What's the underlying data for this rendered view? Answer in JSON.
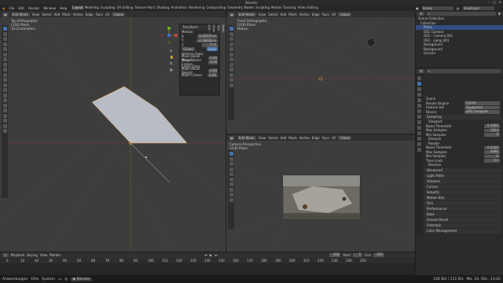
{
  "window": {
    "title": "Blender"
  },
  "menu": [
    "File",
    "Edit",
    "Render",
    "Window",
    "Help"
  ],
  "workspaces": [
    "Layout",
    "Modeling",
    "Sculpting",
    "UV Editing",
    "Texture Paint",
    "Shading",
    "Animation",
    "Rendering",
    "Compositing",
    "Geometry Nodes",
    "Scripting",
    "Motion Tracking",
    "Video Editing"
  ],
  "scene": {
    "label": "Scene",
    "layer": "ViewLayer"
  },
  "editor_header": {
    "mode": "Edit Mode",
    "menus": [
      "View",
      "Select",
      "Add",
      "Mesh",
      "Vertex",
      "Edge",
      "Face",
      "UV"
    ],
    "orientation": "Global",
    "options": "Options"
  },
  "left_viewport": {
    "title": "Top Orthographic",
    "subtitle": "(318) Plane",
    "units": "10 Centimeters"
  },
  "n_panel": {
    "title": "Transform",
    "median": "Median:",
    "x": "X",
    "x_val": "0.32679 m",
    "y": "Y",
    "y_val": "-2.18636 m",
    "z": "Z",
    "z_val": "0 m",
    "local": "Local",
    "global": "Global",
    "vertex_data": "Vertices Data:",
    "vbw": "Mean Bevel Weight",
    "vbw_val": "0.00",
    "vcrease": "Mean Vertex Crease",
    "vcrease_val": "0.00",
    "edge_data": "Edges Data:",
    "ebw": "Mean Bevel Weight",
    "ebw_val": "0.00",
    "ecrease": "Mean Crease",
    "ecrease_val": "0.00",
    "tabs": [
      "Item",
      "Tool",
      "View",
      "Edit"
    ]
  },
  "front_viewport": {
    "title": "Front Orthographic",
    "subtitle": "(318) Plane",
    "units": "Meters"
  },
  "camera_viewport": {
    "title": "Camera Perspective",
    "subtitle": "(318) Plane"
  },
  "outliner": {
    "title": "Scene Collection",
    "rows": [
      {
        "label": "Collection",
        "sel": false
      },
      {
        "label": "Plane",
        "sel": true
      },
      {
        "label": "OSC Camera",
        "sel": false
      },
      {
        "label": "OSC - Camera.001",
        "sel": false
      },
      {
        "label": "OSC - Lamp.001",
        "sel": false
      },
      {
        "label": "Background",
        "sel": false
      },
      {
        "label": "Background",
        "sel": false
      },
      {
        "label": "Ground",
        "sel": false
      }
    ]
  },
  "properties": {
    "scene": "Scene",
    "render_engine_label": "Render Engine",
    "render_engine": "Cycles",
    "feature_set_label": "Feature Set",
    "feature_set": "Supported",
    "device_label": "Device",
    "device": "GPU Compute",
    "sampling": "Sampling",
    "viewport": "Viewport",
    "noise_threshold_label": "Noise Threshold",
    "noise_threshold": "0.1000",
    "max_samples_label": "Max Samples",
    "max_samples": "1024",
    "min_samples_label": "Min Samples",
    "min_samples": "0",
    "denoise": "Denoise",
    "render": "Render",
    "r_noise_label": "Noise Threshold",
    "r_noise": "0.0100",
    "r_max_label": "Max Samples",
    "r_max": "4096",
    "r_min_label": "Min Samples",
    "r_min": "0",
    "time_limit_label": "Time Limit",
    "time_limit": "0 s",
    "r_denoise": "Denoise",
    "sections": [
      "Advanced",
      "Light Paths",
      "Volumes",
      "Curves",
      "Simplify",
      "Motion Blur",
      "Film",
      "Performance",
      "Bake",
      "Grease Pencil",
      "Freestyle",
      "Color Management"
    ]
  },
  "timeline": {
    "menus": [
      "Playback",
      "Keying",
      "View",
      "Marker"
    ],
    "ticks": [
      "0",
      "10",
      "20",
      "30",
      "40",
      "50",
      "60",
      "70",
      "80",
      "90",
      "100",
      "110",
      "120",
      "130",
      "140",
      "150",
      "160",
      "170",
      "180",
      "190",
      "200",
      "210",
      "220",
      "230",
      "240",
      "250"
    ],
    "current": "318",
    "start_label": "Start",
    "start": "1",
    "end_label": "End",
    "end": "350"
  },
  "taskbar": {
    "apps": "Anwendungen",
    "places": "Orte",
    "system": "System",
    "blender": "Blender",
    "net": "126 B/s / 111 B/s",
    "datetime": "Mo, 24. Okt., 13:02"
  }
}
